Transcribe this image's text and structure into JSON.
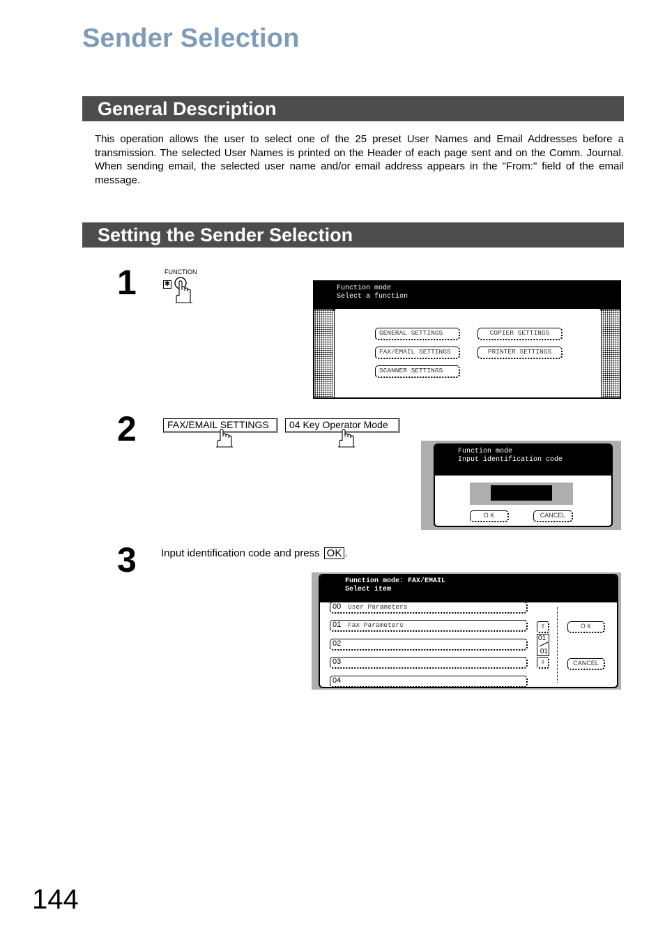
{
  "page": {
    "title": "Sender Selection",
    "page_number": "144"
  },
  "sections": {
    "general": {
      "heading": "General Description",
      "body": "This operation allows the user to select one of the 25 preset User Names and Email Addresses before a transmission.  The selected User Names is printed on the Header of each page sent and on the Comm. Journal.  When sending email, the selected user name and/or email address appears in the \"From:\" field of the email message."
    },
    "setting": {
      "heading": "Setting the Sender Selection"
    }
  },
  "steps": [
    {
      "number": "1",
      "key": {
        "label": "FUNCTION",
        "symbol": "✱",
        "icon": "hand-press-icon"
      },
      "screen": {
        "header_line1": "Function mode",
        "header_line2": "Select a function",
        "buttons": [
          "GENERAL SETTINGS",
          "COPIER SETTINGS",
          "FAX/EMAIL SETTINGS",
          "PRINTER SETTINGS",
          "SCANNER SETTINGS"
        ]
      }
    },
    {
      "number": "2",
      "keys": [
        "FAX/EMAIL SETTINGS",
        "04 Key Operator Mode"
      ],
      "screen": {
        "header_line1": "Function mode",
        "header_line2": "Input identification code",
        "input_value": "",
        "ok": "O K",
        "cancel": "CANCEL"
      }
    },
    {
      "number": "3",
      "instruction": "Input identification code and press",
      "ok_key": "OK",
      "instruction_end": ".",
      "screen": {
        "header_line1": "Function mode: FAX/EMAIL",
        "header_line2": "Select item",
        "items": [
          {
            "num": "00",
            "label": "User Parameters"
          },
          {
            "num": "01",
            "label": "Fax Parameters"
          },
          {
            "num": "02",
            "label": ""
          },
          {
            "num": "03",
            "label": ""
          },
          {
            "num": "04",
            "label": ""
          }
        ],
        "page_current": "01",
        "page_total": "01",
        "ok": "O K",
        "cancel": "CANCEL"
      }
    }
  ],
  "colors": {
    "title": "#7f9bb8",
    "section_bar": "#4d4d4d"
  }
}
